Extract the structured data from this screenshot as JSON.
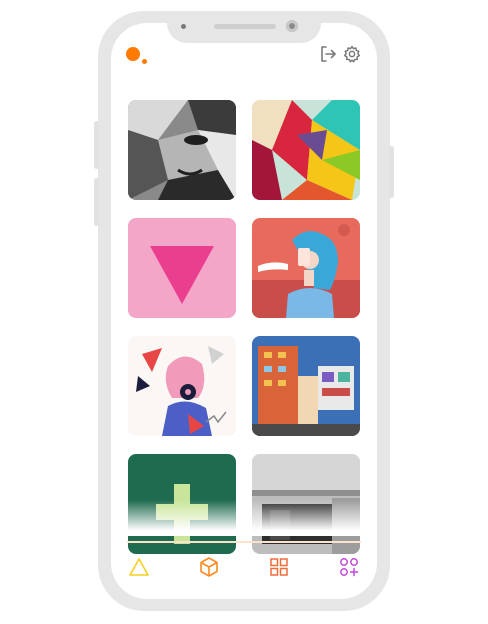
{
  "app": {
    "brand_color": "#ff7a00"
  },
  "header": {
    "logo": "orange-dot-logo",
    "actions": [
      {
        "icon": "logout-icon"
      },
      {
        "icon": "gear-icon"
      }
    ]
  },
  "gallery": {
    "items": [
      {
        "subject": "monochrome-portrait"
      },
      {
        "subject": "colorful-abstract-shapes"
      },
      {
        "subject": "pink-triangle"
      },
      {
        "subject": "woman-taking-selfie"
      },
      {
        "subject": "woman-with-camera-illustration"
      },
      {
        "subject": "colorful-building"
      },
      {
        "subject": "green-plus-sign"
      },
      {
        "subject": "concrete-doorway"
      }
    ]
  },
  "bottom_nav": {
    "accent_colors": [
      "#f5d020",
      "#ff8a1f",
      "#f26b3a",
      "#c04ad8"
    ],
    "items": [
      {
        "icon": "triangle-icon"
      },
      {
        "icon": "cube-icon"
      },
      {
        "icon": "grid-icon"
      },
      {
        "icon": "apps-add-icon"
      }
    ]
  }
}
